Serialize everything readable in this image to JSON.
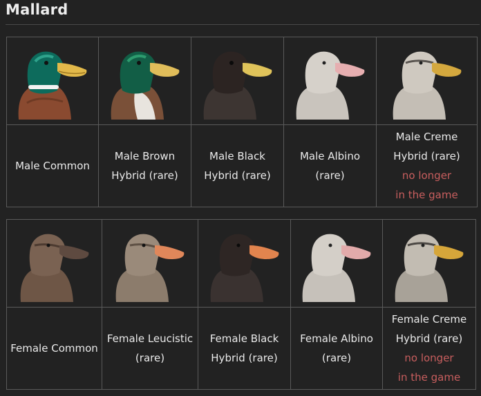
{
  "title": "Mallard",
  "colors": {
    "background": "#222222",
    "border": "#5a5a5a",
    "text": "#eaeaea",
    "note": "#c85e5e"
  },
  "male": [
    {
      "label_lines": [
        "Male Common"
      ],
      "note_lines": [],
      "image": "male-common-duck-portrait"
    },
    {
      "label_lines": [
        "Male Brown",
        "Hybrid (rare)"
      ],
      "note_lines": [],
      "image": "male-brown-hybrid-duck-portrait"
    },
    {
      "label_lines": [
        "Male Black",
        "Hybrid (rare)"
      ],
      "note_lines": [],
      "image": "male-black-hybrid-duck-portrait"
    },
    {
      "label_lines": [
        "Male Albino",
        "(rare)"
      ],
      "note_lines": [],
      "image": "male-albino-duck-portrait"
    },
    {
      "label_lines": [
        "Male Creme",
        "Hybrid (rare)"
      ],
      "note_lines": [
        "no longer",
        "in the game"
      ],
      "image": "male-creme-hybrid-duck-portrait"
    }
  ],
  "female": [
    {
      "label_lines": [
        "Female Common"
      ],
      "note_lines": [],
      "image": "female-common-duck-portrait"
    },
    {
      "label_lines": [
        "Female Leucistic",
        "(rare)"
      ],
      "note_lines": [],
      "image": "female-leucistic-duck-portrait"
    },
    {
      "label_lines": [
        "Female Black",
        "Hybrid (rare)"
      ],
      "note_lines": [],
      "image": "female-black-hybrid-duck-portrait"
    },
    {
      "label_lines": [
        "Female Albino",
        "(rare)"
      ],
      "note_lines": [],
      "image": "female-albino-duck-portrait"
    },
    {
      "label_lines": [
        "Female Creme",
        "Hybrid (rare)"
      ],
      "note_lines": [
        "no longer",
        "in the game"
      ],
      "image": "female-creme-hybrid-duck-portrait"
    }
  ]
}
